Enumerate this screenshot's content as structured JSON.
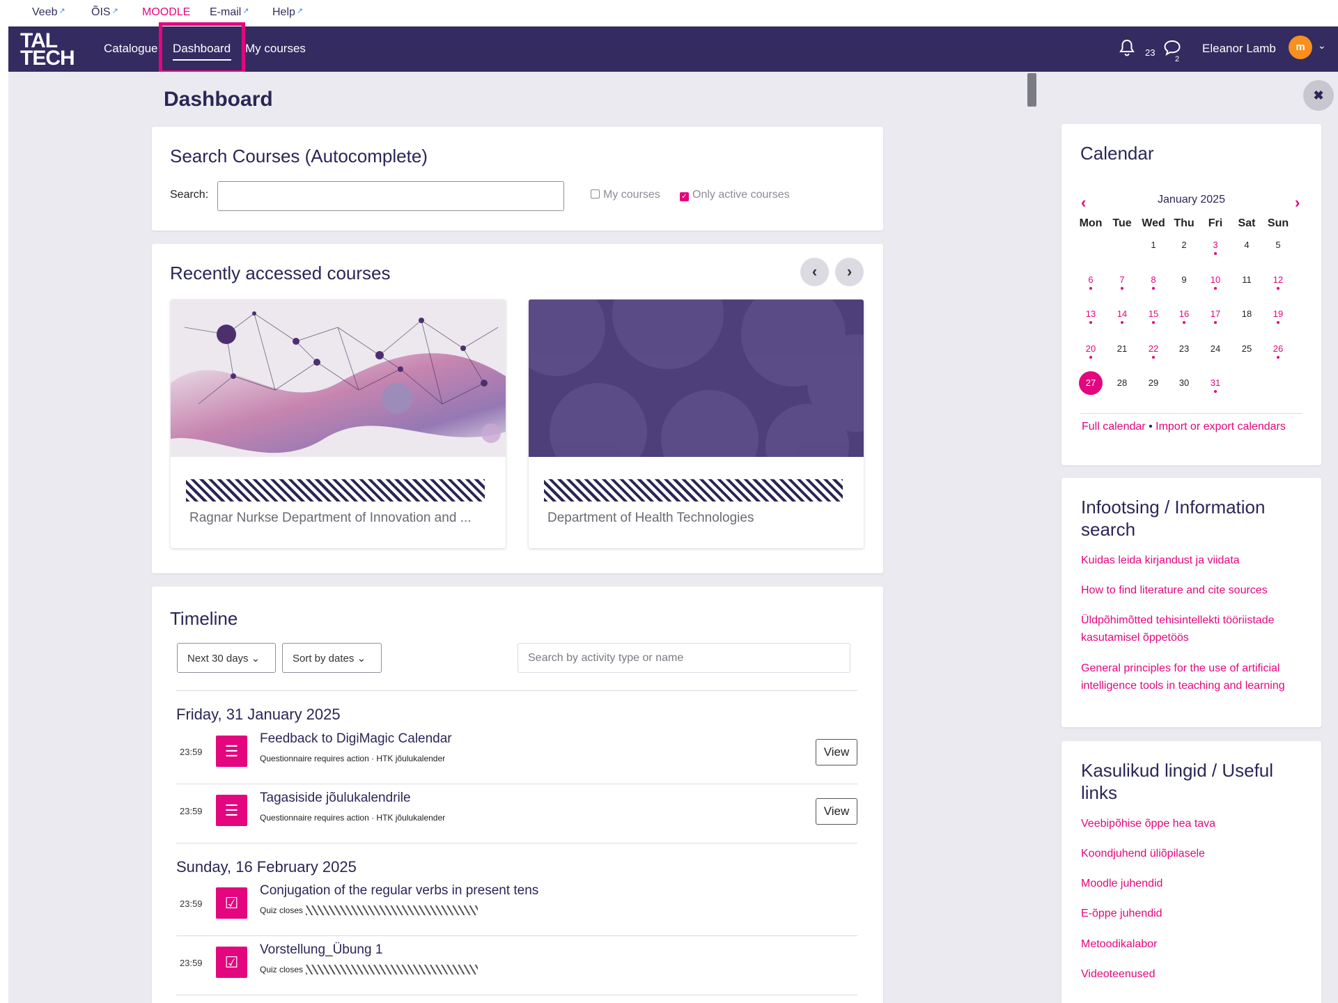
{
  "util_links": [
    {
      "label": "Veeb",
      "external": true
    },
    {
      "label": "ÕIS",
      "external": true
    },
    {
      "label": "MOODLE",
      "external": false
    },
    {
      "label": "E-mail",
      "external": true
    },
    {
      "label": "Help",
      "external": true
    }
  ],
  "external_glyph": "↗",
  "nav": {
    "logo_line1": "TAL",
    "logo_line2": "TECH",
    "items": [
      "Catalogue",
      "Dashboard",
      "My courses"
    ],
    "active": "Dashboard",
    "notifications_count": "23",
    "messages_count": "2",
    "user_name": "Eleanor Lamb",
    "avatar_text": "m",
    "avatar_color": "#f7901e"
  },
  "page_title": "Dashboard",
  "search_block": {
    "title": "Search Courses (Autocomplete)",
    "label": "Search:",
    "value": "",
    "my_courses_label": "My courses",
    "my_courses_checked": false,
    "active_label": "Only active courses",
    "active_checked": true
  },
  "recent": {
    "title": "Recently accessed courses",
    "courses": [
      {
        "name": "Ragnar Nurkse Department of Innovation and ..."
      },
      {
        "name": "Department of Health Technologies"
      }
    ]
  },
  "timeline": {
    "title": "Timeline",
    "filter": "Next 30 days",
    "sort": "Sort by dates",
    "search_placeholder": "Search by activity type or name",
    "groups": [
      {
        "date": "Friday, 31 January 2025",
        "items": [
          {
            "time": "23:59",
            "title": "Feedback to DigiMagic Calendar",
            "subtitle": "Questionnaire requires action · HTK jõulukalender",
            "action": "View",
            "icon": "questionnaire-icon"
          },
          {
            "time": "23:59",
            "title": "Tagasiside jõulukalendrile",
            "subtitle": "Questionnaire requires action · HTK jõulukalender",
            "action": "View",
            "icon": "questionnaire-icon"
          }
        ]
      },
      {
        "date": "Sunday, 16 February 2025",
        "items": [
          {
            "time": "23:59",
            "title": "Conjugation of the regular verbs in present tens",
            "subtitle": "Quiz closes",
            "icon": "quiz-icon"
          },
          {
            "time": "23:59",
            "title": "Vorstellung_Übung 1",
            "subtitle": "Quiz closes",
            "icon": "quiz-icon"
          }
        ]
      }
    ]
  },
  "calendar": {
    "title": "Calendar",
    "month": "January 2025",
    "weekdays": [
      "Mon",
      "Tue",
      "Wed",
      "Thu",
      "Fri",
      "Sat",
      "Sun"
    ],
    "weeks": [
      [
        null,
        null,
        1,
        2,
        3,
        4,
        5
      ],
      [
        6,
        7,
        8,
        9,
        10,
        11,
        12
      ],
      [
        13,
        14,
        15,
        16,
        17,
        18,
        19
      ],
      [
        20,
        21,
        22,
        23,
        24,
        25,
        26
      ],
      [
        27,
        28,
        29,
        30,
        31,
        null,
        null
      ]
    ],
    "event_days": [
      3,
      6,
      7,
      8,
      10,
      12,
      13,
      14,
      15,
      16,
      17,
      19,
      20,
      22,
      26,
      31
    ],
    "today": 27,
    "full_link": "Full calendar",
    "separator": "•",
    "export_link": "Import or export calendars"
  },
  "info_block": {
    "title": "Infootsing / Information search",
    "links": [
      "Kuidas leida kirjandust ja viidata",
      "How to find literature and cite sources",
      "Üldpõhimõtted tehisintellekti tööriistade kasutamisel õppetöös",
      "General principles for the use of artificial intelligence tools in teaching and learning"
    ]
  },
  "useful_block": {
    "title": "Kasulikud lingid / Useful links",
    "links": [
      "Veebipõhise õppe hea tava",
      "Koondjuhend üliõpilasele",
      "Moodle juhendid",
      "E-õppe juhendid",
      "Metoodikalabor",
      "Videoteenused"
    ]
  },
  "colors": {
    "brand": "#342b60",
    "accent": "#e4067e",
    "bg": "#ebeaf0"
  }
}
